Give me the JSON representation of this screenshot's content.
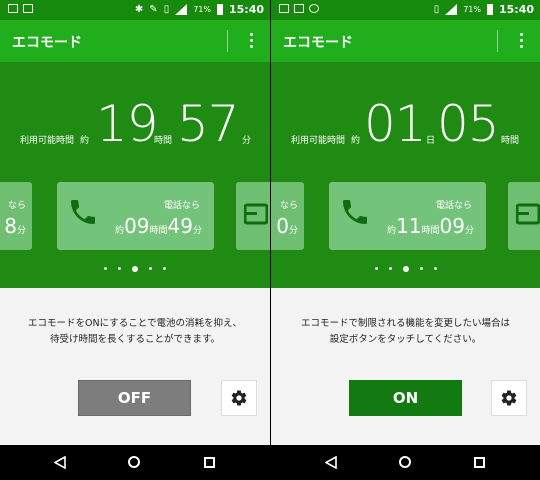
{
  "left": {
    "status": {
      "battery": "71%",
      "time": "15:40"
    },
    "app_title": "エコモード",
    "remain_label": "利用可能時間",
    "approx": "約",
    "hours": "19",
    "hours_unit": "時間",
    "minutes": "57",
    "minutes_unit": "分",
    "left_card": {
      "label": "なら",
      "value": "8",
      "unit": "分"
    },
    "main_card": {
      "label": "電話なら",
      "approx": "約",
      "h": "09",
      "h_unit": "時間",
      "m": "49",
      "m_unit": "分"
    },
    "description_lines": [
      "エコモードをONにすることで電池の消耗を抑え、",
      "待受け時間を長くすることができます。"
    ],
    "toggle_label": "OFF"
  },
  "right": {
    "status": {
      "battery": "71%",
      "time": "15:40"
    },
    "app_title": "エコモード",
    "remain_label": "利用可能時間",
    "approx": "約",
    "days": "01",
    "days_unit": "日",
    "hours": "05",
    "hours_unit": "時間",
    "left_card": {
      "label": "なら",
      "value": "0",
      "unit": "分"
    },
    "main_card": {
      "label": "電話なら",
      "approx": "約",
      "h": "11",
      "h_unit": "時間",
      "m": "09",
      "m_unit": "分"
    },
    "description_lines": [
      "エコモードで制限される機能を変更したい場合は",
      "設定ボタンをタッチしてください。"
    ],
    "toggle_label": "ON"
  },
  "colors": {
    "appbar": "#21ae1c",
    "main_green": "#1f8b12",
    "card": "#74c37a",
    "toggle_off": "#7d7d7d",
    "toggle_on": "#127a10"
  },
  "icons": [
    "phone-icon",
    "gear-icon",
    "overflow-menu-icon",
    "back-icon",
    "home-icon",
    "recents-icon"
  ]
}
